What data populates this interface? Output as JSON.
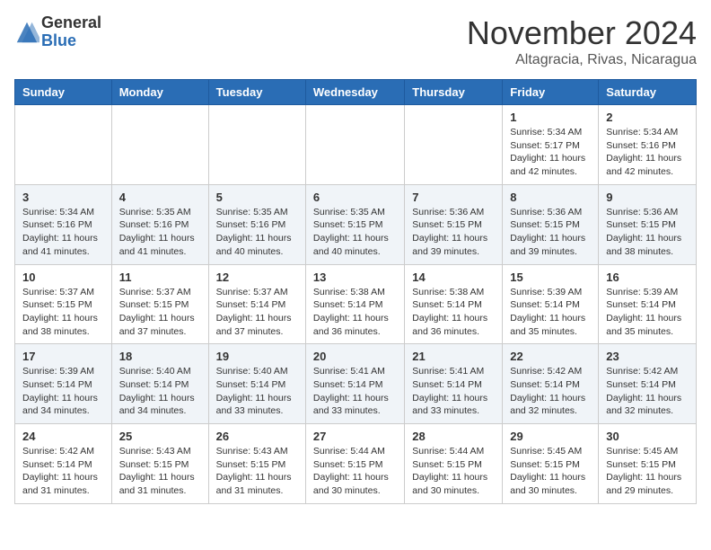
{
  "header": {
    "logo_general": "General",
    "logo_blue": "Blue",
    "month": "November 2024",
    "location": "Altagracia, Rivas, Nicaragua"
  },
  "weekdays": [
    "Sunday",
    "Monday",
    "Tuesday",
    "Wednesday",
    "Thursday",
    "Friday",
    "Saturday"
  ],
  "weeks": [
    [
      {
        "day": "",
        "sunrise": "",
        "sunset": "",
        "daylight": ""
      },
      {
        "day": "",
        "sunrise": "",
        "sunset": "",
        "daylight": ""
      },
      {
        "day": "",
        "sunrise": "",
        "sunset": "",
        "daylight": ""
      },
      {
        "day": "",
        "sunrise": "",
        "sunset": "",
        "daylight": ""
      },
      {
        "day": "",
        "sunrise": "",
        "sunset": "",
        "daylight": ""
      },
      {
        "day": "1",
        "sunrise": "Sunrise: 5:34 AM",
        "sunset": "Sunset: 5:17 PM",
        "daylight": "Daylight: 11 hours and 42 minutes."
      },
      {
        "day": "2",
        "sunrise": "Sunrise: 5:34 AM",
        "sunset": "Sunset: 5:16 PM",
        "daylight": "Daylight: 11 hours and 42 minutes."
      }
    ],
    [
      {
        "day": "3",
        "sunrise": "Sunrise: 5:34 AM",
        "sunset": "Sunset: 5:16 PM",
        "daylight": "Daylight: 11 hours and 41 minutes."
      },
      {
        "day": "4",
        "sunrise": "Sunrise: 5:35 AM",
        "sunset": "Sunset: 5:16 PM",
        "daylight": "Daylight: 11 hours and 41 minutes."
      },
      {
        "day": "5",
        "sunrise": "Sunrise: 5:35 AM",
        "sunset": "Sunset: 5:16 PM",
        "daylight": "Daylight: 11 hours and 40 minutes."
      },
      {
        "day": "6",
        "sunrise": "Sunrise: 5:35 AM",
        "sunset": "Sunset: 5:15 PM",
        "daylight": "Daylight: 11 hours and 40 minutes."
      },
      {
        "day": "7",
        "sunrise": "Sunrise: 5:36 AM",
        "sunset": "Sunset: 5:15 PM",
        "daylight": "Daylight: 11 hours and 39 minutes."
      },
      {
        "day": "8",
        "sunrise": "Sunrise: 5:36 AM",
        "sunset": "Sunset: 5:15 PM",
        "daylight": "Daylight: 11 hours and 39 minutes."
      },
      {
        "day": "9",
        "sunrise": "Sunrise: 5:36 AM",
        "sunset": "Sunset: 5:15 PM",
        "daylight": "Daylight: 11 hours and 38 minutes."
      }
    ],
    [
      {
        "day": "10",
        "sunrise": "Sunrise: 5:37 AM",
        "sunset": "Sunset: 5:15 PM",
        "daylight": "Daylight: 11 hours and 38 minutes."
      },
      {
        "day": "11",
        "sunrise": "Sunrise: 5:37 AM",
        "sunset": "Sunset: 5:15 PM",
        "daylight": "Daylight: 11 hours and 37 minutes."
      },
      {
        "day": "12",
        "sunrise": "Sunrise: 5:37 AM",
        "sunset": "Sunset: 5:14 PM",
        "daylight": "Daylight: 11 hours and 37 minutes."
      },
      {
        "day": "13",
        "sunrise": "Sunrise: 5:38 AM",
        "sunset": "Sunset: 5:14 PM",
        "daylight": "Daylight: 11 hours and 36 minutes."
      },
      {
        "day": "14",
        "sunrise": "Sunrise: 5:38 AM",
        "sunset": "Sunset: 5:14 PM",
        "daylight": "Daylight: 11 hours and 36 minutes."
      },
      {
        "day": "15",
        "sunrise": "Sunrise: 5:39 AM",
        "sunset": "Sunset: 5:14 PM",
        "daylight": "Daylight: 11 hours and 35 minutes."
      },
      {
        "day": "16",
        "sunrise": "Sunrise: 5:39 AM",
        "sunset": "Sunset: 5:14 PM",
        "daylight": "Daylight: 11 hours and 35 minutes."
      }
    ],
    [
      {
        "day": "17",
        "sunrise": "Sunrise: 5:39 AM",
        "sunset": "Sunset: 5:14 PM",
        "daylight": "Daylight: 11 hours and 34 minutes."
      },
      {
        "day": "18",
        "sunrise": "Sunrise: 5:40 AM",
        "sunset": "Sunset: 5:14 PM",
        "daylight": "Daylight: 11 hours and 34 minutes."
      },
      {
        "day": "19",
        "sunrise": "Sunrise: 5:40 AM",
        "sunset": "Sunset: 5:14 PM",
        "daylight": "Daylight: 11 hours and 33 minutes."
      },
      {
        "day": "20",
        "sunrise": "Sunrise: 5:41 AM",
        "sunset": "Sunset: 5:14 PM",
        "daylight": "Daylight: 11 hours and 33 minutes."
      },
      {
        "day": "21",
        "sunrise": "Sunrise: 5:41 AM",
        "sunset": "Sunset: 5:14 PM",
        "daylight": "Daylight: 11 hours and 33 minutes."
      },
      {
        "day": "22",
        "sunrise": "Sunrise: 5:42 AM",
        "sunset": "Sunset: 5:14 PM",
        "daylight": "Daylight: 11 hours and 32 minutes."
      },
      {
        "day": "23",
        "sunrise": "Sunrise: 5:42 AM",
        "sunset": "Sunset: 5:14 PM",
        "daylight": "Daylight: 11 hours and 32 minutes."
      }
    ],
    [
      {
        "day": "24",
        "sunrise": "Sunrise: 5:42 AM",
        "sunset": "Sunset: 5:14 PM",
        "daylight": "Daylight: 11 hours and 31 minutes."
      },
      {
        "day": "25",
        "sunrise": "Sunrise: 5:43 AM",
        "sunset": "Sunset: 5:15 PM",
        "daylight": "Daylight: 11 hours and 31 minutes."
      },
      {
        "day": "26",
        "sunrise": "Sunrise: 5:43 AM",
        "sunset": "Sunset: 5:15 PM",
        "daylight": "Daylight: 11 hours and 31 minutes."
      },
      {
        "day": "27",
        "sunrise": "Sunrise: 5:44 AM",
        "sunset": "Sunset: 5:15 PM",
        "daylight": "Daylight: 11 hours and 30 minutes."
      },
      {
        "day": "28",
        "sunrise": "Sunrise: 5:44 AM",
        "sunset": "Sunset: 5:15 PM",
        "daylight": "Daylight: 11 hours and 30 minutes."
      },
      {
        "day": "29",
        "sunrise": "Sunrise: 5:45 AM",
        "sunset": "Sunset: 5:15 PM",
        "daylight": "Daylight: 11 hours and 30 minutes."
      },
      {
        "day": "30",
        "sunrise": "Sunrise: 5:45 AM",
        "sunset": "Sunset: 5:15 PM",
        "daylight": "Daylight: 11 hours and 29 minutes."
      }
    ]
  ]
}
